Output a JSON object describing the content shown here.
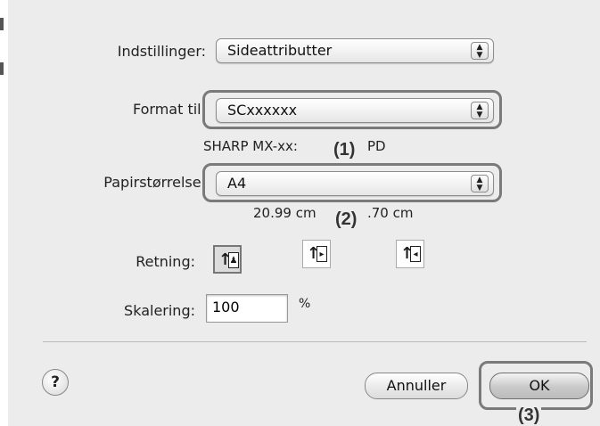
{
  "dialog": {
    "settings_label": "Indstillinger:",
    "settings_value": "Sideattributter",
    "format_label": "Format til:",
    "format_value": "SCxxxxxx",
    "printer_desc_left": "SHARP MX-xx:",
    "printer_desc_right": "PD",
    "paper_label": "Papirstørrelse:",
    "paper_value": "A4",
    "paper_dims_left": "20.99 cm",
    "paper_dims_right": ".70 cm",
    "orientation_label": "Retning:",
    "orientation_options": [
      {
        "name": "portrait",
        "selected": true
      },
      {
        "name": "landscape-left",
        "selected": false
      },
      {
        "name": "landscape-right",
        "selected": false
      }
    ],
    "scale_label": "Skalering:",
    "scale_value": "100",
    "scale_unit": "%",
    "help_glyph": "?",
    "cancel_label": "Annuller",
    "ok_label": "OK"
  },
  "callouts": {
    "one": "(1)",
    "two": "(2)",
    "three": "(3)"
  },
  "icons": {
    "popup": "up-down-stepper-icon",
    "help": "help-icon"
  }
}
